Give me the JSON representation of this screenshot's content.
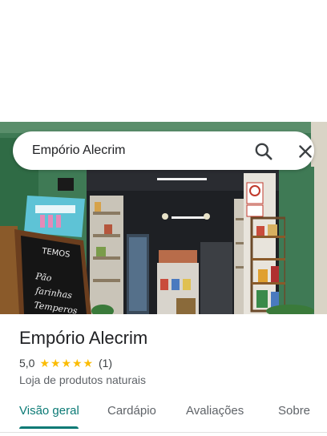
{
  "search": {
    "query": "Empório Alecrim",
    "search_icon": "search-icon",
    "close_icon": "close-icon"
  },
  "photo": {
    "sign_lines": [
      "TEMOS",
      "Pão",
      "farinhas",
      "Temperos"
    ]
  },
  "place": {
    "name": "Empório Alecrim",
    "rating": "5,0",
    "stars": 5,
    "review_count": "(1)",
    "category": "Loja de produtos naturais"
  },
  "tabs": [
    {
      "label": "Visão geral",
      "active": true
    },
    {
      "label": "Cardápio",
      "active": false
    },
    {
      "label": "Avaliações",
      "active": false
    },
    {
      "label": "Sobre",
      "active": false
    }
  ],
  "colors": {
    "accent": "#0b7a75",
    "star": "#fbbc04",
    "storefront_green": "#3f7a55"
  }
}
